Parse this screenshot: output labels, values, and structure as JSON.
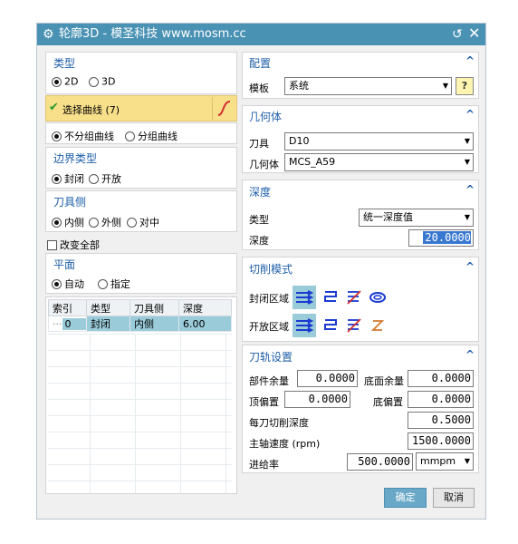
{
  "window": {
    "title": "轮廓3D - 模圣科技 www.mosm.cc",
    "reset_icon": "reset-icon",
    "close_icon": "close-icon"
  },
  "left": {
    "type_section": {
      "title": "类型",
      "opt_2d": "2D",
      "opt_3d": "3D",
      "selected": "2D"
    },
    "select_curve": {
      "label": "选择曲线 (7)",
      "icon": "curve-icon"
    },
    "group": {
      "opt_ungroup": "不分组曲线",
      "opt_group": "分组曲线",
      "selected": "不分组曲线"
    },
    "boundary": {
      "title": "边界类型",
      "opt_closed": "封闭",
      "opt_open": "开放",
      "selected": "封闭"
    },
    "tool_side": {
      "title": "刀具侧",
      "opt_in": "内侧",
      "opt_out": "外侧",
      "opt_on": "对中",
      "selected": "内侧"
    },
    "change_all": {
      "label": "改变全部",
      "checked": false
    },
    "plane": {
      "title": "平面",
      "opt_auto": "自动",
      "opt_specify": "指定",
      "selected": "自动"
    },
    "table": {
      "headers": [
        "索引",
        "类型",
        "刀具侧",
        "深度"
      ],
      "rows": [
        [
          "0",
          "封闭",
          "内侧",
          "6.00"
        ]
      ]
    }
  },
  "right": {
    "config": {
      "title": "配置",
      "template_label": "模板",
      "template_value": "系统"
    },
    "geometry": {
      "title": "几何体",
      "tool_label": "刀具",
      "tool_value": "D10",
      "geom_label": "几何体",
      "geom_value": "MCS_A59"
    },
    "depth": {
      "title": "深度",
      "type_label": "类型",
      "type_value": "统一深度值",
      "depth_label": "深度",
      "depth_value": "20.0000"
    },
    "cut_mode": {
      "title": "切削模式",
      "closed_label": "封闭区域",
      "open_label": "开放区域"
    },
    "toolpath": {
      "title": "刀轨设置",
      "part_stock_label": "部件余量",
      "part_stock_value": "0.0000",
      "floor_stock_label": "底面余量",
      "floor_stock_value": "0.0000",
      "top_offset_label": "顶偏置",
      "top_offset_value": "0.0000",
      "floor_offset_label": "底偏置",
      "floor_offset_value": "0.0000",
      "step_depth_label": "每刀切削深度",
      "step_depth_value": "0.5000",
      "spindle_label": "主轴速度 (rpm)",
      "spindle_value": "1500.0000",
      "feed_label": "进给率",
      "feed_value": "500.0000",
      "feed_unit": "mmpm"
    }
  },
  "buttons": {
    "ok": "确定",
    "cancel": "取消"
  },
  "colors": {
    "title_bar": "#4a92b4",
    "highlight": "#f8df8a",
    "section_title": "#1f5fa8",
    "selected_row": "#9acbd9"
  }
}
